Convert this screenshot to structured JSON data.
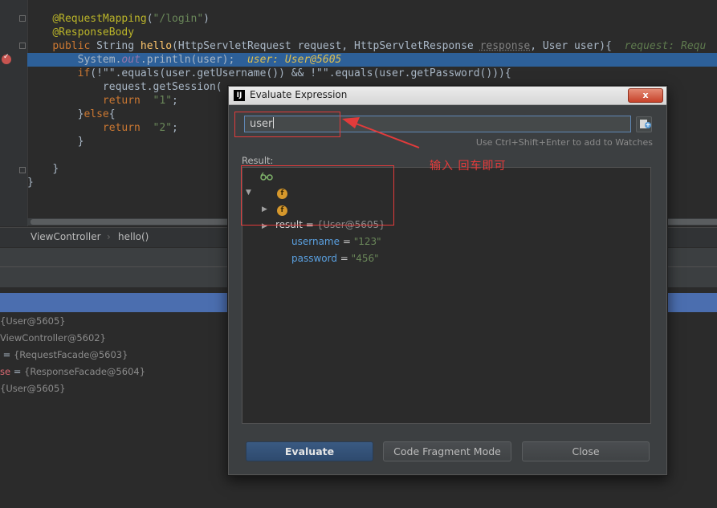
{
  "editor": {
    "lines": [
      {
        "indent": "    ",
        "annotation": "@RequestMapping",
        "paren_open": "(",
        "str": "\"/login\"",
        "paren_close": ")"
      },
      {
        "indent": "    ",
        "annotation": "@ResponseBody"
      },
      {
        "indent": "    ",
        "kw1": "public",
        "type": " String ",
        "fn": "hello",
        "params": "(HttpServletRequest request, HttpServletResponse ",
        "param_faded": "response",
        "params_end": ", User user){",
        "inline_hint": "request: Requ"
      },
      {
        "indent": "        ",
        "code_a": "System.",
        "field": "out",
        "code_b": ".println(user);",
        "inline_hint": "user: User@5605"
      },
      {
        "indent": "        ",
        "kw1": "if",
        "code": "(!\"\".equals(user.getUsername()) && !\"\".equals(user.getPassword())){"
      },
      {
        "indent": "            ",
        "code": "request.getSession("
      },
      {
        "indent": "            ",
        "kw1": "return",
        "str": "  \"1\"",
        "code": ";"
      },
      {
        "indent": "        ",
        "code_a": "}",
        "kw1": "else",
        "code_b": "{"
      },
      {
        "indent": "            ",
        "kw1": "return",
        "str": "  \"2\"",
        "code": ";"
      },
      {
        "indent": "        ",
        "code": "}"
      },
      {
        "indent": "",
        "code": ""
      },
      {
        "indent": "    ",
        "code": "}"
      },
      {
        "indent": "",
        "code": "}"
      }
    ]
  },
  "breadcrumb": {
    "class_name": "ViewController",
    "separator": "›",
    "method_name": "hello()"
  },
  "variables": [
    {
      "name": "",
      "eq": "",
      "value": "{User@5605}"
    },
    {
      "name": "",
      "eq": "",
      "value": "ViewController@5602}"
    },
    {
      "name": "",
      "eq": " = ",
      "value": "{RequestFacade@5603}"
    },
    {
      "name": "se",
      "eq": " = ",
      "value": "{ResponseFacade@5604}"
    },
    {
      "name": "",
      "eq": "",
      "value": "{User@5605}"
    }
  ],
  "dialog": {
    "title": "Evaluate Expression",
    "app_icon_text": "IJ",
    "close_symbol": "x",
    "expression_value": "user",
    "hint": "Use Ctrl+Shift+Enter to add to Watches",
    "result_label": "Result:",
    "tree": [
      {
        "name": "result",
        "eq": " = ",
        "value": "{User@5605}"
      },
      {
        "name": "username",
        "eq": " = ",
        "value": "\"123\""
      },
      {
        "name": "password",
        "eq": " = ",
        "value": "\"456\""
      }
    ],
    "field_icon_letter": "f",
    "buttons": {
      "evaluate": "Evaluate",
      "code_fragment": "Code Fragment Mode",
      "close": "Close"
    }
  },
  "annotation_note": "输入  回车即可",
  "colors": {
    "annotation_red": "#e23b3b",
    "exec_line": "#2d6099",
    "selection": "#4b6eaf"
  }
}
